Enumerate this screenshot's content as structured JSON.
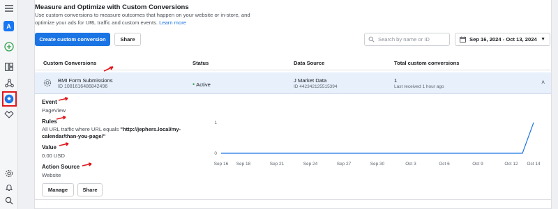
{
  "rail": {
    "avatar_letter": "A",
    "icons": [
      "menu-icon",
      "plus-circle-icon",
      "layout-icon",
      "connections-icon",
      "star-badge-icon",
      "handshake-icon",
      "settings-icon",
      "bell-icon",
      "search-icon"
    ],
    "highlight_color": "#e0151b"
  },
  "header": {
    "title": "Measure and Optimize with Custom Conversions",
    "description": "Use custom conversions to measure outcomes that happen on your website or in-store, and optimize your ads for URL traffic and custom events.",
    "learn_more": "Learn more"
  },
  "toolbar": {
    "create_label": "Create custom conversion",
    "share_label": "Share",
    "search_placeholder": "Search by name or ID",
    "date_range": "Sep 16, 2024 - Oct 13, 2024"
  },
  "table": {
    "columns": [
      "Custom Conversions",
      "Status",
      "Data Source",
      "Total custom conversions"
    ],
    "row": {
      "name": "BMI Form Submissions",
      "id": "ID 1081616486842496",
      "status": "Active",
      "data_source": "J Market Data",
      "data_source_id": "ID 442342125515394",
      "total": "1",
      "last_received": "Last received 1 hour ago"
    }
  },
  "detail": {
    "event_label": "Event",
    "event_value": "PageView",
    "rules_label": "Rules",
    "rules_prefix": "All URL traffic where URL equals ",
    "rules_url_1": "\"http://jephers.local/my-",
    "rules_url_2": "calendar/than-you-page/\"",
    "value_label": "Value",
    "value_value": "0.00 USD",
    "action_label": "Action Source",
    "action_value": "Website",
    "manage_label": "Manage",
    "share_label": "Share"
  },
  "colors": {
    "primary": "#1b74e4",
    "row_highlight": "#e7f0fb",
    "annotation": "#e0151b",
    "active": "#31a24c"
  },
  "chart_data": {
    "type": "line",
    "title": "",
    "xlabel": "",
    "ylabel": "",
    "x_ticks": [
      "Sep 16",
      "Sep 18",
      "Sep 21",
      "Sep 24",
      "Sep 27",
      "Sep 30",
      "Oct 3",
      "Oct 6",
      "Oct 9",
      "Oct 12",
      "Oct 14"
    ],
    "y_ticks": [
      "1",
      "0"
    ],
    "ylim": [
      0,
      1
    ],
    "grid": false,
    "series": [
      {
        "color": "#1b74e4",
        "x": [
          "Sep 16",
          "Sep 17",
          "Sep 18",
          "Sep 19",
          "Sep 20",
          "Sep 21",
          "Sep 22",
          "Sep 23",
          "Sep 24",
          "Sep 25",
          "Sep 26",
          "Sep 27",
          "Sep 28",
          "Sep 29",
          "Sep 30",
          "Oct 1",
          "Oct 2",
          "Oct 3",
          "Oct 4",
          "Oct 5",
          "Oct 6",
          "Oct 7",
          "Oct 8",
          "Oct 9",
          "Oct 10",
          "Oct 11",
          "Oct 12",
          "Oct 13",
          "Oct 14"
        ],
        "values": [
          0,
          0,
          0,
          0,
          0,
          0,
          0,
          0,
          0,
          0,
          0,
          0,
          0,
          0,
          0,
          0,
          0,
          0,
          0,
          0,
          0,
          0,
          0,
          0,
          0,
          0,
          0,
          0,
          1
        ]
      }
    ]
  }
}
